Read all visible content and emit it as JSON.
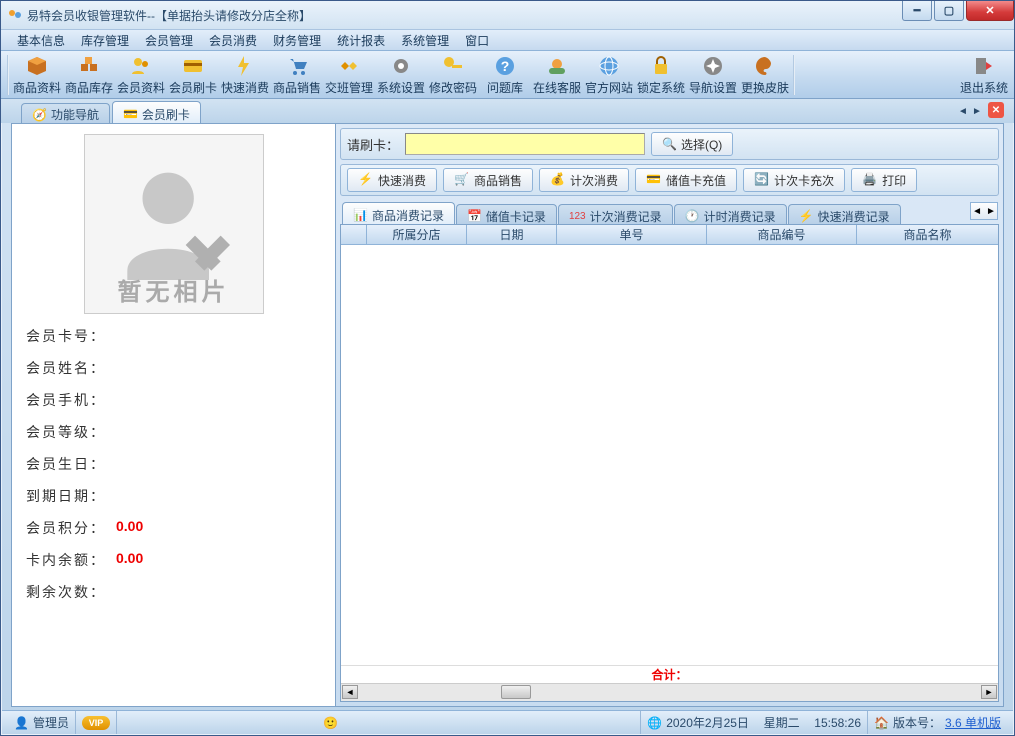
{
  "window": {
    "title": "易特会员收银管理软件--【单据抬头请修改分店全称】"
  },
  "menus": [
    "基本信息",
    "库存管理",
    "会员管理",
    "会员消费",
    "财务管理",
    "统计报表",
    "系统管理",
    "窗口"
  ],
  "toolbar": [
    {
      "id": "product-data",
      "label": "商品资料"
    },
    {
      "id": "product-stock",
      "label": "商品库存"
    },
    {
      "id": "member-data",
      "label": "会员资料"
    },
    {
      "id": "member-swipe",
      "label": "会员刷卡"
    },
    {
      "id": "quick-consume",
      "label": "快速消费"
    },
    {
      "id": "product-sale",
      "label": "商品销售"
    },
    {
      "id": "shift-manage",
      "label": "交班管理"
    },
    {
      "id": "sys-setting",
      "label": "系统设置"
    },
    {
      "id": "change-pwd",
      "label": "修改密码"
    },
    {
      "id": "faq",
      "label": "问题库"
    },
    {
      "id": "online-service",
      "label": "在线客服"
    },
    {
      "id": "official-site",
      "label": "官方网站"
    },
    {
      "id": "lock-system",
      "label": "锁定系统"
    },
    {
      "id": "nav-setting",
      "label": "导航设置"
    },
    {
      "id": "change-skin",
      "label": "更换皮肤"
    },
    {
      "id": "exit-system",
      "label": "退出系统"
    }
  ],
  "page_tabs": {
    "t0": "功能导航",
    "t1": "会员刷卡"
  },
  "swipe": {
    "label": "请刷卡：",
    "select_label": "选择(Q)"
  },
  "actions": {
    "a0": "快速消费",
    "a1": "商品销售",
    "a2": "计次消费",
    "a3": "储值卡充值",
    "a4": "计次卡充次",
    "a5": "打印"
  },
  "subtabs": {
    "s0": "商品消费记录",
    "s1": "储值卡记录",
    "s2": "计次消费记录",
    "s3": "计时消费记录",
    "s4": "快速消费记录"
  },
  "grid": {
    "cols": {
      "c1": "所属分店",
      "c2": "日期",
      "c3": "单号",
      "c4": "商品编号",
      "c5": "商品名称"
    },
    "total_label": "合计："
  },
  "member": {
    "photo_text": "暂无相片",
    "f_card": "会员卡号：",
    "f_name": "会员姓名：",
    "f_phone": "会员手机：",
    "f_level": "会员等级：",
    "f_birth": "会员生日：",
    "f_expire": "到期日期：",
    "f_points": "会员积分：",
    "f_balance": "卡内余额：",
    "f_remain": "剩余次数：",
    "v_points": "0.00",
    "v_balance": "0.00"
  },
  "status": {
    "user": "管理员",
    "date": "2020年2月25日",
    "weekday": "星期二",
    "time": "15:58:26",
    "ver_label": "版本号：",
    "ver_value": "3.6 单机版"
  }
}
